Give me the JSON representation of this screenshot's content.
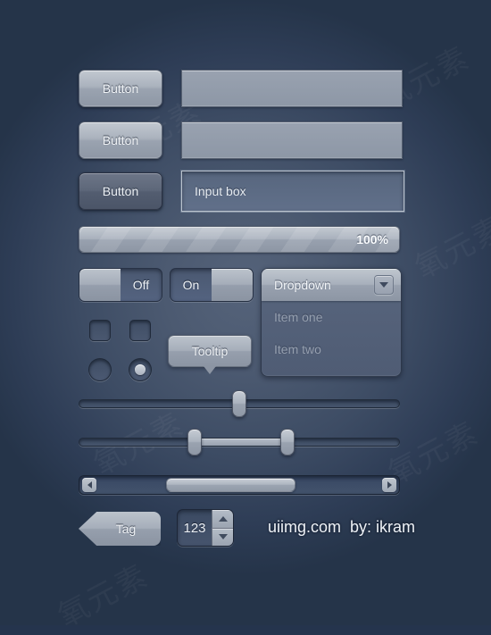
{
  "theme": {
    "bg_dark": "#25344d",
    "bg_center": "#55637a",
    "control_light": "#aab2bd",
    "control_dark": "#5d6779",
    "text_light": "#f2f5f8",
    "text_muted": "#96a0b0"
  },
  "watermarks": [
    "氧元素",
    "氧元素",
    "氧元素",
    "氧元素",
    "氧元素",
    "氧元素"
  ],
  "buttons": [
    {
      "label": "Button",
      "state": "normal"
    },
    {
      "label": "Button",
      "state": "normal"
    },
    {
      "label": "Button",
      "state": "pressed"
    }
  ],
  "inputs": [
    {
      "value": "",
      "placeholder": "",
      "state": "filled"
    },
    {
      "value": "",
      "placeholder": "",
      "state": "filled"
    },
    {
      "value": "Input box",
      "placeholder": "Input box",
      "state": "active"
    }
  ],
  "progress": {
    "label": "100%",
    "percent": 100
  },
  "toggles": [
    {
      "label": "Off",
      "state": "off"
    },
    {
      "label": "On",
      "state": "on"
    }
  ],
  "dropdown": {
    "selected": "Dropdown",
    "arrow_icon": "chevron-down-icon",
    "items": [
      "Item one",
      "Item two"
    ]
  },
  "checkboxes": [
    {
      "checked": false
    },
    {
      "checked": false
    }
  ],
  "radios": [
    {
      "checked": false
    },
    {
      "checked": true
    }
  ],
  "tooltip": {
    "label": "Tooltip"
  },
  "sliders": [
    {
      "type": "single",
      "value": 50
    },
    {
      "type": "range",
      "low": 36,
      "high": 65
    }
  ],
  "scrollbar": {
    "left_icon": "arrow-left-icon",
    "right_icon": "arrow-right-icon",
    "thumb_start": 24,
    "thumb_width": 46
  },
  "tag": {
    "label": "Tag"
  },
  "stepper": {
    "value": "123",
    "up_icon": "caret-up-icon",
    "down_icon": "caret-down-icon"
  },
  "credit": {
    "text": "uiimg.com  by: ikram"
  }
}
